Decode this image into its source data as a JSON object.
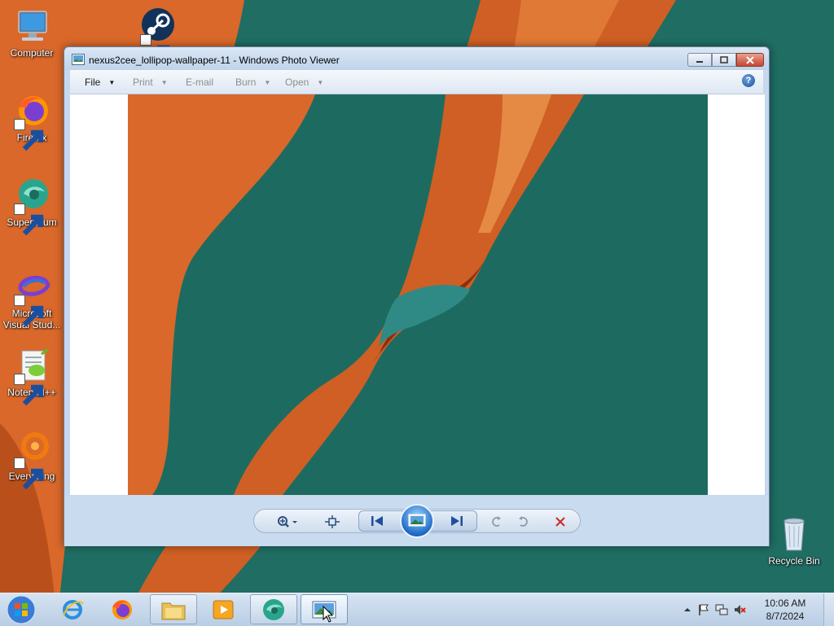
{
  "desktop": {
    "icons": [
      {
        "label": "Computer"
      },
      {
        "label": "Firefox"
      },
      {
        "label": "Supermium"
      },
      {
        "label": "Microsoft Visual Stud..."
      },
      {
        "label": "Notepad++"
      },
      {
        "label": "Everything"
      }
    ],
    "recycle_bin": {
      "label": "Recycle Bin"
    }
  },
  "window": {
    "title": "nexus2cee_lollipop-wallpaper-11 - Windows Photo Viewer",
    "menu": [
      {
        "label": "File",
        "has_arrow": true,
        "enabled": true
      },
      {
        "label": "Print",
        "has_arrow": true,
        "enabled": false
      },
      {
        "label": "E-mail",
        "has_arrow": false,
        "enabled": false
      },
      {
        "label": "Burn",
        "has_arrow": true,
        "enabled": false
      },
      {
        "label": "Open",
        "has_arrow": true,
        "enabled": false
      }
    ],
    "help_label": "?",
    "controls": [
      "zoom",
      "actual-size",
      "previous",
      "slide-show",
      "next",
      "rotate-counterclockwise",
      "rotate-clockwise",
      "delete"
    ]
  },
  "taskbar": {
    "pinned": [
      "internet-explorer",
      "firefox",
      "windows-explorer",
      "media-player",
      "supermium",
      "photo-viewer"
    ],
    "clock": {
      "time": "10:06 AM",
      "date": "8/7/2024"
    }
  },
  "colors": {
    "orange": "#d9682a",
    "teal": "#1f6d63",
    "close_red": "#c8452f",
    "accent_blue": "#1f6bc6"
  }
}
